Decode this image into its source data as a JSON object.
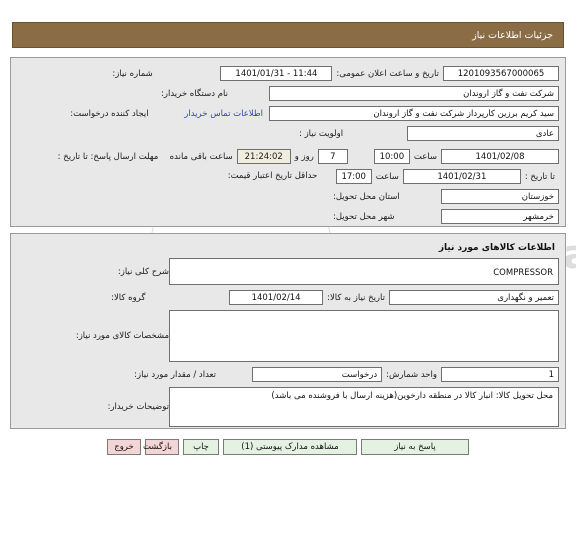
{
  "window": {
    "title": "جزئیات اطلاعات نیاز"
  },
  "watermark": {
    "line1": "ParsNamadData",
    "line2": "مرکز فرآوری اطلاعات پارس نماد داده ها",
    "line3": "پایگاه اطلاع رسانی مناقصه و مزایدات",
    "line4": "۰۲۱-۸۸۲۶۷۲۴۰-۵"
  },
  "section1": {
    "fields": {
      "need_number_label": "شماره نیاز:",
      "need_number_value": "1201093567000065",
      "announce_datetime_label": "تاریخ و ساعت اعلان عمومی:",
      "announce_datetime_value": "1401/01/31 - 11:44",
      "buyer_org_label": "نام دستگاه خریدار:",
      "buyer_org_value": "شرکت نفت و گاز اروندان",
      "requester_label": "ایجاد کننده درخواست:",
      "requester_value": "سید کریم برزین کارپرداز شرکت نفت و گاز اروندان",
      "contact_link": "اطلاعات تماس خریدار",
      "priority_label": "اولویت نیاز :",
      "priority_value": "عادی",
      "reply_deadline_label": "مهلت ارسال پاسخ: تا تاریخ :",
      "reply_deadline_date": "1401/02/08",
      "reply_hour_label": "ساعت",
      "reply_hour_value": "10:00",
      "days_value": "7",
      "days_word": "روز و",
      "countdown_value": "21:24:02",
      "remaining_text": "ساعت باقی مانده",
      "price_validity_label": "حداقل تاریخ اعتبار قیمت:",
      "price_validity_until_label": "تا تاریخ :",
      "price_validity_date": "1401/02/31",
      "price_hour_label": "ساعت",
      "price_hour_value": "17:00",
      "province_label": "استان محل تحویل:",
      "province_value": "خوزستان",
      "city_label": "شهر محل تحویل:",
      "city_value": "خرمشهر"
    }
  },
  "section2": {
    "heading": "اطلاعات کالاهای مورد نیاز",
    "fields": {
      "general_desc_label": "شرح کلی نیاز:",
      "general_desc_value": "COMPRESSOR",
      "goods_group_label": "گروه کالا:",
      "goods_group_value": "تعمیر و نگهداری",
      "need_date_label": "تاریخ نیاز به کالا:",
      "need_date_value": "1401/02/14",
      "specs_label": "مشخصات کالای مورد نیاز:",
      "specs_value": "",
      "quantity_label": "تعداد / مقدار مورد نیاز:",
      "quantity_value": "1",
      "unit_label": "واحد شمارش:",
      "unit_value": "درخواست",
      "buyer_notes_label": "توضیحات خریدار:",
      "buyer_notes_value": "محل تحویل کالا: انبار کالا در منطقه  دارخوین(هزینه ارسال با فروشنده می باشد)"
    }
  },
  "buttons": [
    {
      "label": "پاسخ به نیاز",
      "style": "green",
      "name": "respond-button"
    },
    {
      "label": "مشاهده مدارک پیوستی (1)",
      "style": "green",
      "name": "view-attachments-button"
    },
    {
      "label": "چاپ",
      "style": "green",
      "name": "print-button"
    },
    {
      "label": "بازگشت",
      "style": "red",
      "name": "back-button"
    },
    {
      "label": "خروج",
      "style": "red",
      "name": "exit-button"
    }
  ],
  "colors": {
    "titlebar_bg": "#8a6d44",
    "timer_bg": "#efeedd",
    "link": "#2f3fb0",
    "btn_green": "#e4f2e1",
    "btn_red": "#f4d5d5",
    "panel_bg": "#e8e8e8"
  }
}
